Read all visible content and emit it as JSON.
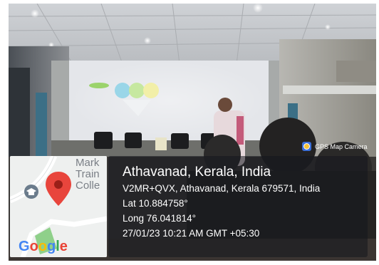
{
  "badge": {
    "label": "GPS Map Camera",
    "icon": "gps-map-camera-icon"
  },
  "map": {
    "labels": [
      "Mark",
      "Train",
      "Colle"
    ],
    "logo": {
      "G": "G",
      "o1": "o",
      "o2": "o",
      "g": "g",
      "l": "l",
      "e": "e"
    },
    "pin_color": "#e8453c"
  },
  "location": {
    "title": "Athavanad, Kerala, India",
    "address": "V2MR+QVX, Athavanad, Kerala 679571, India",
    "lat": "Lat 10.884758°",
    "long": "Long 76.041814°",
    "timestamp": "27/01/23 10:21 AM GMT +05:30"
  }
}
